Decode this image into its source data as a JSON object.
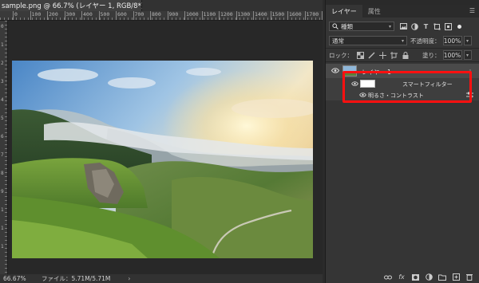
{
  "document": {
    "tab_title": "sample.png @ 66.7% (レイヤー 1, RGB/8*) *",
    "close_icon": "×",
    "ruler_top": [
      "0",
      "100",
      "200",
      "300",
      "400",
      "500",
      "600",
      "700",
      "800",
      "900",
      "1000",
      "1100",
      "1200",
      "1300",
      "1400",
      "1500",
      "1600",
      "1700",
      "1800",
      "1900"
    ],
    "ruler_left": [
      "0",
      "1",
      "2",
      "3",
      "4",
      "5",
      "6",
      "7",
      "8",
      "9",
      "1",
      "1",
      "1"
    ]
  },
  "status_bar": {
    "zoom": "66.67%",
    "file_info": "ファイル：5.71M/5.71M",
    "arrow": "›"
  },
  "panel": {
    "tabs": [
      "レイヤー",
      "属性"
    ],
    "menu_icon": "☰",
    "filter": {
      "kind": "種類",
      "search_icon": "🔍",
      "icons": [
        "image-filter-icon",
        "adjustment-filter-icon",
        "type-filter-icon",
        "shape-filter-icon",
        "smartobject-filter-icon"
      ]
    },
    "blend": {
      "mode": "通常",
      "opacity_label": "不透明度：",
      "opacity_value": "100%"
    },
    "lock": {
      "label": "ロック：",
      "fill_label": "塗り：",
      "fill_value": "100%"
    },
    "layers": {
      "layer_name": "レイヤー 1",
      "smart_filter_label": "スマートフィルター",
      "adjustment_label": "明るさ・コントラスト"
    },
    "bottom_icons": [
      "link-icon",
      "fx-icon",
      "mask-icon",
      "adjustment-icon",
      "group-icon",
      "new-layer-icon",
      "trash-icon"
    ]
  },
  "colors": {
    "highlight": "#ff1010",
    "panel_bg": "#353535",
    "selected_layer": "#4a4a4a"
  }
}
